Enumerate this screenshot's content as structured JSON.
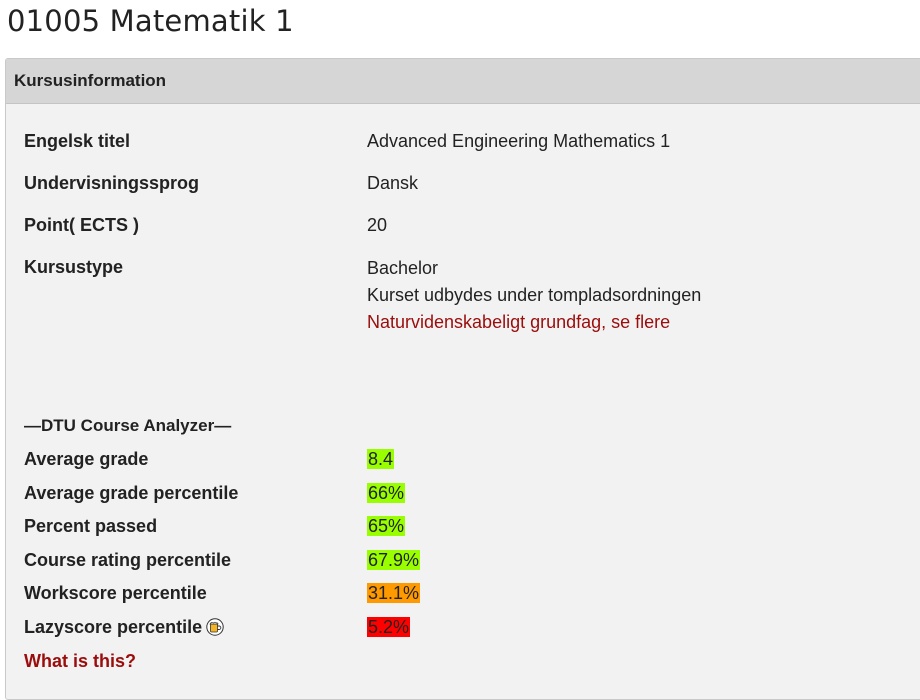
{
  "course": {
    "title": "01005 Matematik 1"
  },
  "panel": {
    "header": "Kursusinformation",
    "rows": [
      {
        "label": "Engelsk titel",
        "value": "Advanced Engineering Mathematics 1"
      },
      {
        "label": "Undervisningssprog",
        "value": "Dansk"
      },
      {
        "label": "Point( ECTS )",
        "value": "20"
      },
      {
        "label": "Kursustype",
        "values": [
          "Bachelor",
          "Kurset udbydes under tompladsordningen"
        ],
        "link": "Naturvidenskabeligt grundfag, se flere"
      }
    ]
  },
  "analyzer": {
    "title": "—DTU Course Analyzer—",
    "metrics": [
      {
        "label": "Average grade",
        "value": "8.4",
        "color": "#99ff00"
      },
      {
        "label": "Average grade percentile",
        "value": "66%",
        "color": "#99ff00"
      },
      {
        "label": "Percent passed",
        "value": "65%",
        "color": "#99ff00"
      },
      {
        "label": "Course rating percentile",
        "value": "67.9%",
        "color": "#99ff00"
      },
      {
        "label": "Workscore percentile",
        "value": "31.1%",
        "color": "#ff9900"
      },
      {
        "label": "Lazyscore percentile",
        "value": "5.2%",
        "color": "#ff0000",
        "icon": "beer-icon"
      }
    ],
    "help_link": "What is this?"
  },
  "colors": {
    "link": "#9b0c0c",
    "header_bg": "#d6d6d6",
    "panel_bg": "#f2f2f2"
  }
}
